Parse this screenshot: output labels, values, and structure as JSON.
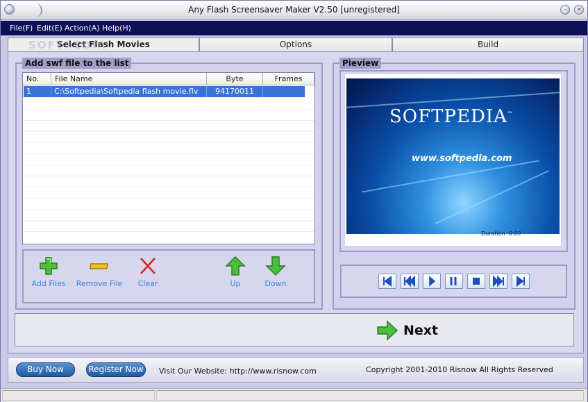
{
  "window": {
    "title": "Any Flash Screensaver Maker V2.50 [unregistered]"
  },
  "menu": [
    "File(F)",
    "Edit(E)",
    "Action(A)",
    "Help(H)"
  ],
  "tabs": [
    "Select Flash Movies",
    "Options",
    "Build"
  ],
  "list_group": {
    "title": "Add swf file to the list",
    "columns": [
      "No.",
      "File Name",
      "Byte",
      "Frames"
    ],
    "rows": [
      {
        "no": "1",
        "file": "C:\\Softpedia\\Softpedia flash movie.flv",
        "byte": "94170011",
        "frames": ""
      }
    ]
  },
  "actions": {
    "add_files": "Add Files",
    "remove_file": "Remove File",
    "clear": "Clear",
    "up": "Up",
    "down": "Down"
  },
  "preview": {
    "title": "Pieview",
    "logo_text": "SOFTPEDIA",
    "trademark": "™",
    "url_text": "www.softpedia.com",
    "duration": "Duration :0:02"
  },
  "next_label": "Next",
  "bottom": {
    "buy_now": "Buy Now",
    "register_now": "Register Now",
    "website": "Visit Our Website: http://www.risnow.com",
    "copyright": "Copyright 2001-2010 Risnow All Rights Reserved"
  },
  "watermark": "SOFTPEDIA",
  "colors": {
    "menubar": "#101058",
    "selection": "#3874d8",
    "action_text": "#3b83d4",
    "panel": "#d2d2ec"
  },
  "icons": {
    "add": "plus-icon",
    "remove": "minus-icon",
    "clear": "x-icon",
    "up": "arrow-up-icon",
    "down": "arrow-down-icon",
    "next": "arrow-right-icon",
    "player": [
      "skip-first-icon",
      "rewind-icon",
      "play-icon",
      "pause-icon",
      "stop-icon",
      "fast-forward-icon",
      "skip-last-icon"
    ]
  }
}
